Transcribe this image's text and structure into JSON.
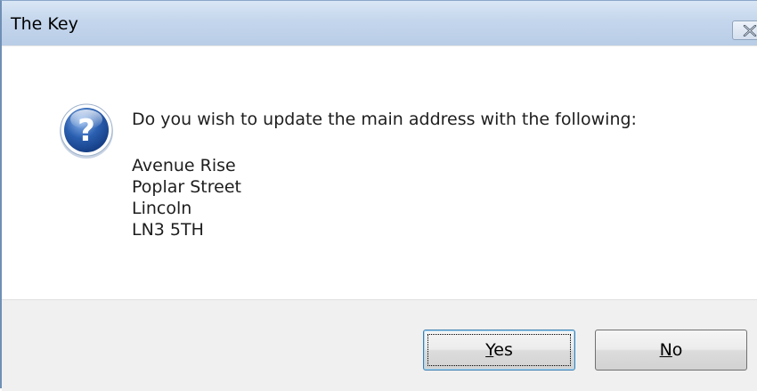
{
  "window": {
    "title": "The Key"
  },
  "dialog": {
    "icon": "question-icon",
    "message": "Do you wish to update the main address with the following:",
    "address_lines": [
      "Avenue Rise",
      "Poplar Street",
      "Lincoln",
      "LN3 5TH"
    ]
  },
  "buttons": {
    "yes": {
      "mnemonic": "Y",
      "rest": "es"
    },
    "no": {
      "mnemonic": "N",
      "rest": "o"
    }
  },
  "colors": {
    "titlebar": "#c4d6ec",
    "footer": "#f0f0f0",
    "icon_blue": "#2a5fb0"
  }
}
